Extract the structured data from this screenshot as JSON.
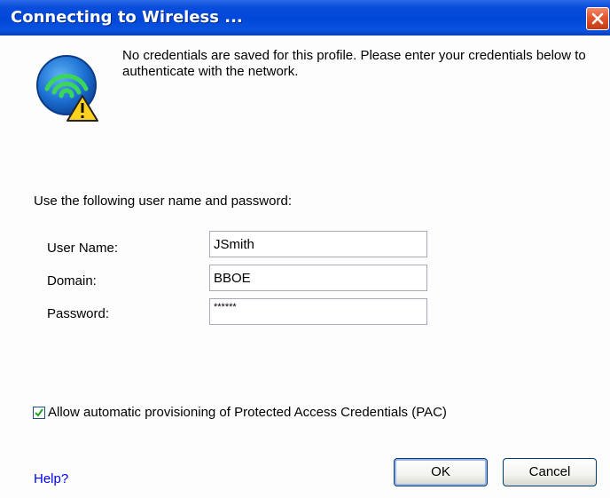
{
  "window": {
    "title": "Connecting to Wireless ..."
  },
  "message": "No credentials are saved for this profile. Please enter your credentials below to authenticate with the network.",
  "form": {
    "section_label": "Use the following user name and password:",
    "user_name": {
      "label": "User Name:",
      "value": "JSmith"
    },
    "domain": {
      "label": "Domain:",
      "value": "BBOE"
    },
    "password": {
      "label": "Password:",
      "value": "******"
    }
  },
  "pac_checkbox": {
    "label": "Allow automatic provisioning of Protected Access Credentials (PAC)",
    "checked": true
  },
  "help_link": "Help?",
  "buttons": {
    "ok": "OK",
    "cancel": "Cancel"
  },
  "colors": {
    "titlebar": "#0047d8",
    "close": "#e2572c",
    "link": "#0000ff"
  },
  "icons": {
    "close": "close-icon",
    "network": "wireless-network-warning-icon",
    "check": "checkmark-icon"
  }
}
